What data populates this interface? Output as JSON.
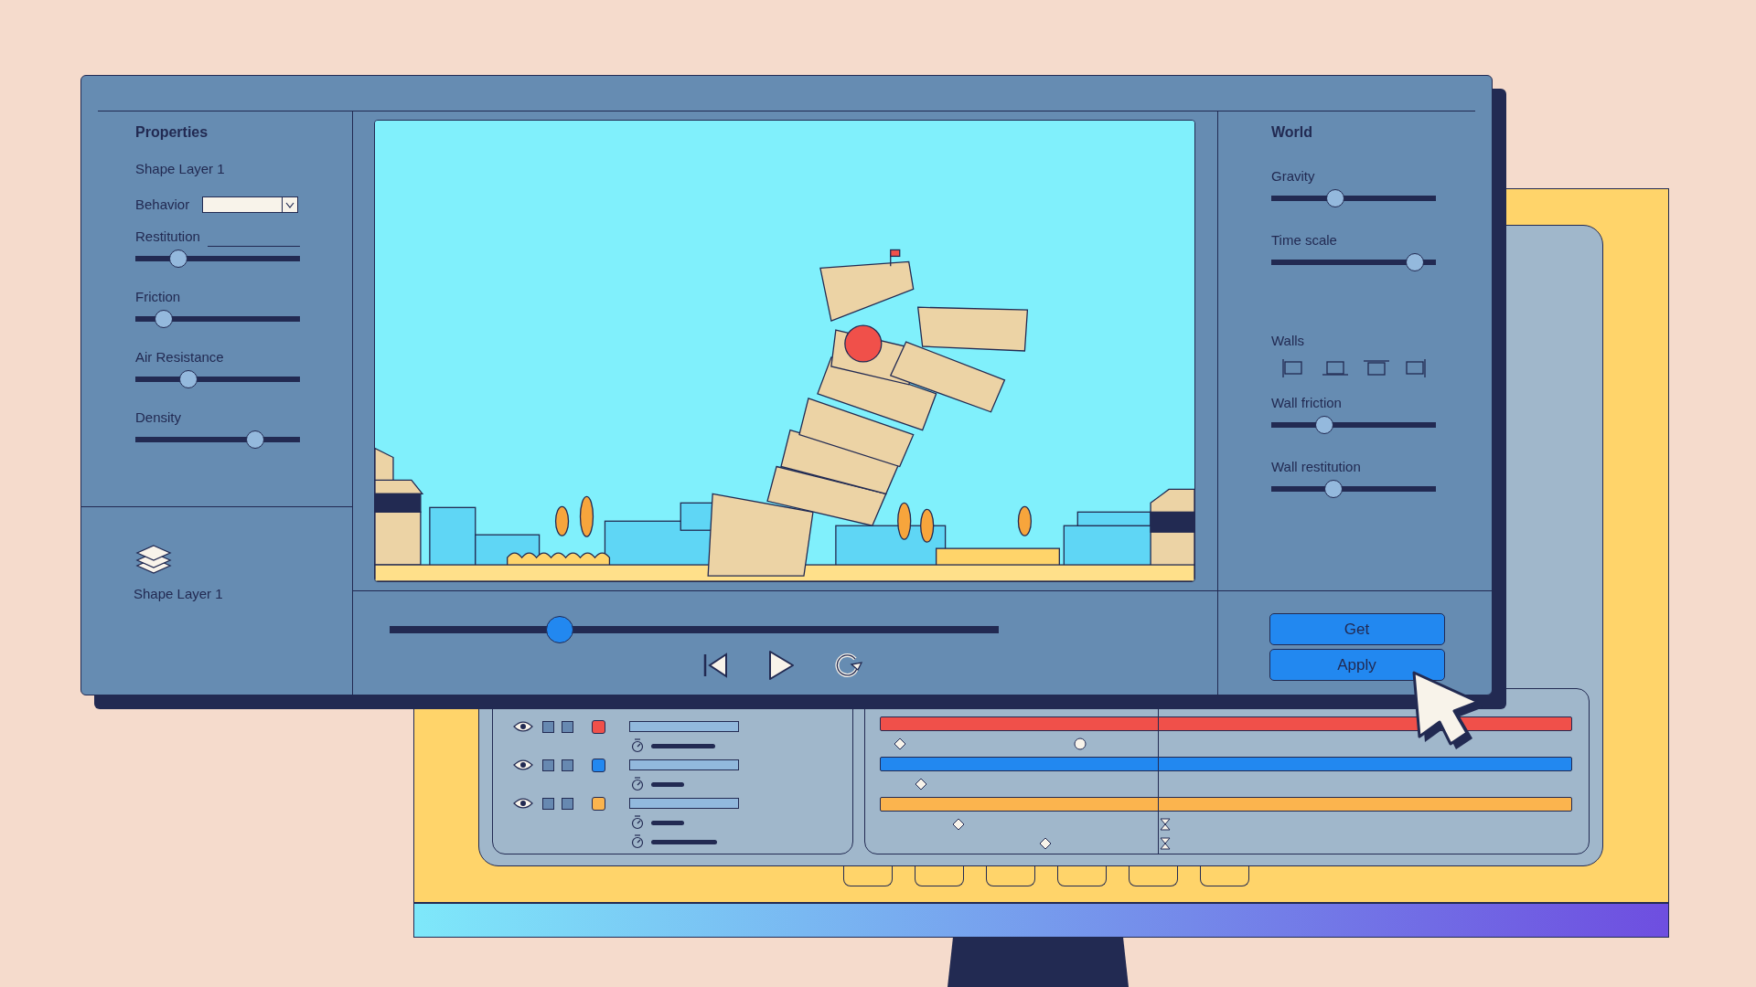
{
  "properties": {
    "title": "Properties",
    "layer_name": "Shape Layer 1",
    "behavior_label": "Behavior",
    "sliders": [
      {
        "label": "Restitution",
        "level": 0.26,
        "kind": "field"
      },
      {
        "label": "Friction",
        "level": 0.17,
        "kind": "plain"
      },
      {
        "label": "Air Resistance",
        "level": 0.32,
        "kind": "plain"
      },
      {
        "label": "Density",
        "level": 0.73,
        "kind": "plain"
      }
    ]
  },
  "layers": [
    {
      "name": "Shape Layer 1"
    }
  ],
  "playback": {
    "level": 0.28
  },
  "world": {
    "title": "World",
    "sliders": [
      {
        "label": "Gravity",
        "level": 0.39
      },
      {
        "label": "Time scale",
        "level": 0.87
      }
    ],
    "walls_label": "Walls",
    "walls": [
      {
        "kind": "left"
      },
      {
        "kind": "bottom"
      },
      {
        "kind": "top"
      },
      {
        "kind": "right"
      }
    ],
    "wall_sliders": [
      {
        "label": "Wall friction",
        "level": 0.32
      },
      {
        "label": "Wall restitution",
        "level": 0.38
      }
    ]
  },
  "buttons": [
    "Get",
    "Apply"
  ],
  "tracks": [
    {
      "color": "#f0504a",
      "keyframe_rows": [
        {
          "keyframes": [
            {
              "kind": "diamond"
            },
            {
              "kind": "circle"
            }
          ]
        }
      ]
    },
    {
      "color": "#2288f0",
      "keyframe_rows": [
        {
          "keyframes": [
            {
              "kind": "diamond"
            }
          ]
        }
      ]
    },
    {
      "color": "#fbb44e",
      "keyframe_rows": [
        {
          "keyframes": [
            {
              "kind": "diamond"
            },
            {
              "kind": "hourglass"
            }
          ]
        },
        {
          "keyframes": [
            {
              "kind": "diamond"
            },
            {
              "kind": "hourglass"
            }
          ]
        }
      ]
    }
  ]
}
